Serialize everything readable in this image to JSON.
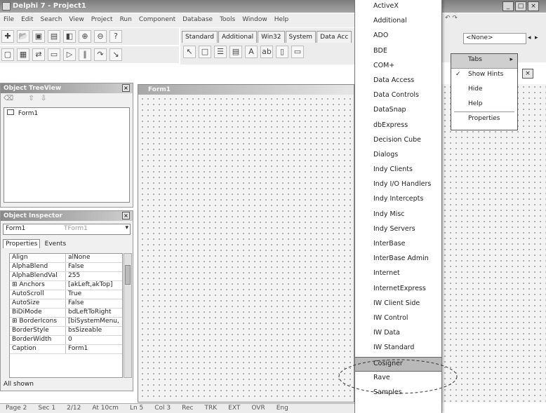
{
  "window": {
    "title": "Delphi 7 - Project1"
  },
  "menu": [
    "File",
    "Edit",
    "Search",
    "View",
    "Project",
    "Run",
    "Component",
    "Database",
    "Tools",
    "Window",
    "Help"
  ],
  "toolbar": {
    "row1_icons": [
      "new-icon",
      "open-icon",
      "save-icon",
      "save-all-icon",
      "open-project-icon",
      "add-file-icon",
      "remove-file-icon",
      "help-icon"
    ],
    "row2_icons": [
      "view-unit-icon",
      "view-form-icon",
      "toggle-form-unit-icon",
      "new-form-icon",
      "run-icon",
      "pause-icon",
      "step-over-icon",
      "trace-into-icon"
    ]
  },
  "palette": {
    "tabs": [
      "Standard",
      "Additional",
      "Win32",
      "System",
      "Data Acc"
    ],
    "component_icons": [
      "pointer-icon",
      "frames-icon",
      "main-menu-icon",
      "popup-menu-icon",
      "label-icon",
      "edit-icon",
      "memo-icon",
      "button-icon"
    ]
  },
  "object_treeview": {
    "title": "Object TreeView",
    "root": "Form1"
  },
  "object_inspector": {
    "title": "Object Inspector",
    "selected_object": "Form1",
    "selected_type": "TForm1",
    "tabs": [
      "Properties",
      "Events"
    ],
    "rows": [
      {
        "name": "Align",
        "value": "alNone"
      },
      {
        "name": "AlphaBlend",
        "value": "False"
      },
      {
        "name": "AlphaBlendVal",
        "value": "255"
      },
      {
        "name": "⊞ Anchors",
        "value": "[akLeft,akTop]"
      },
      {
        "name": "AutoScroll",
        "value": "True"
      },
      {
        "name": "AutoSize",
        "value": "False"
      },
      {
        "name": "BiDiMode",
        "value": "bdLeftToRight"
      },
      {
        "name": "⊞ BorderIcons",
        "value": "[biSystemMenu,"
      },
      {
        "name": "BorderStyle",
        "value": "bsSizeable"
      },
      {
        "name": "BorderWidth",
        "value": "0"
      },
      {
        "name": "Caption",
        "value": "Form1"
      }
    ],
    "footer": "All shown"
  },
  "form_designer": {
    "title": "Form1"
  },
  "palette_tabs_popup": {
    "items": [
      "ActiveX",
      "Additional",
      "ADO",
      "BDE",
      "COM+",
      "Data Access",
      "Data Controls",
      "DataSnap",
      "dbExpress",
      "Decision Cube",
      "Dialogs",
      "Indy Clients",
      "Indy I/O Handlers",
      "Indy Intercepts",
      "Indy Misc",
      "Indy Servers",
      "InterBase",
      "InterBase Admin",
      "Internet",
      "InternetExpress",
      "IW Client Side",
      "IW Control",
      "IW Data",
      "IW Standard",
      "Rave",
      "Samples"
    ],
    "selected_label": "Cosigner",
    "selected_index": 24
  },
  "context_menu": {
    "items": [
      "Tabs",
      "Show Hints",
      "Hide",
      "Help",
      "Properties"
    ],
    "checked": "Show Hints",
    "submenu_arrow": "▸"
  },
  "right_toolbar": {
    "visible_text": "<None>",
    "palette_tab_right": "Internet"
  },
  "statusbar": [
    "Page 2",
    "Sec 1",
    "2/12",
    "At 10cm",
    "Ln 5",
    "Col 3",
    "Rec",
    "TRK",
    "EXT",
    "OVR",
    "Eng"
  ]
}
